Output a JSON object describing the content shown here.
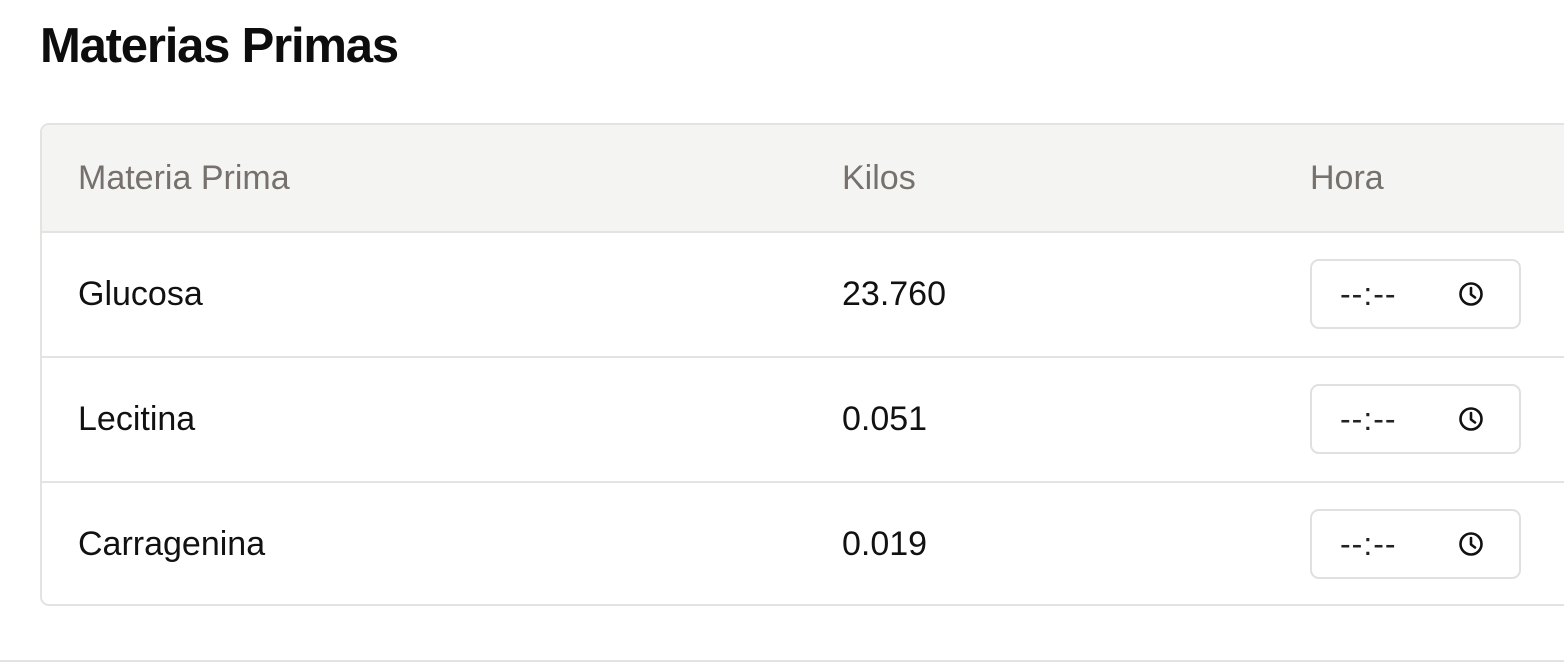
{
  "page": {
    "title": "Materias Primas"
  },
  "table": {
    "columns": [
      "Materia Prima",
      "Kilos",
      "Hora"
    ],
    "rows": [
      {
        "materia_prima": "Glucosa",
        "kilos": "23.760",
        "hora_placeholder": "--:--",
        "hora_icon": "clock-icon"
      },
      {
        "materia_prima": "Lecitina",
        "kilos": "0.051",
        "hora_placeholder": "--:--",
        "hora_icon": "clock-icon"
      },
      {
        "materia_prima": "Carragenina",
        "kilos": "0.019",
        "hora_placeholder": "--:--",
        "hora_icon": "clock-icon"
      }
    ]
  },
  "colors": {
    "header_background": "#f4f4f2",
    "header_text": "#77716d",
    "border": "#e3e3e1",
    "text": "#111111"
  }
}
